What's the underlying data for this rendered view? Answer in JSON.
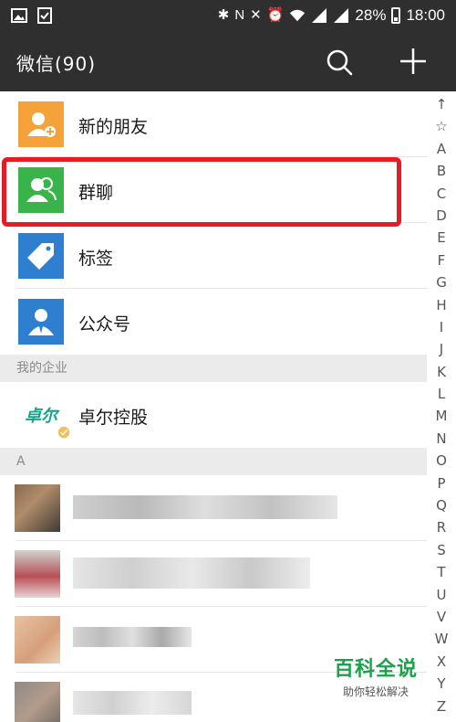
{
  "status_bar": {
    "battery": "28%",
    "time": "18:00",
    "icons": [
      "image-icon",
      "checklist-icon",
      "bluetooth-icon",
      "nfc-icon",
      "mute-icon",
      "alarm-icon",
      "wifi-icon",
      "signal-icon",
      "signal-icon",
      "battery-icon"
    ]
  },
  "header": {
    "title": "微信(90)",
    "search_icon": "search-icon",
    "add_icon": "plus-icon"
  },
  "top_items": [
    {
      "label": "新的朋友",
      "icon": "new-friend-icon",
      "color": "#f5a23a"
    },
    {
      "label": "群聊",
      "icon": "group-chat-icon",
      "color": "#3ab44a"
    },
    {
      "label": "标签",
      "icon": "tag-icon",
      "color": "#2f7fd1"
    },
    {
      "label": "公众号",
      "icon": "official-account-icon",
      "color": "#2f7fd1"
    }
  ],
  "enterprise_section": {
    "header": "我的企业",
    "item": {
      "label": "卓尔控股",
      "logo_text": "卓尔",
      "logo_color": "#18a38a"
    }
  },
  "contacts_section": {
    "header": "A"
  },
  "index_letters": [
    "↑",
    "☆",
    "A",
    "B",
    "C",
    "D",
    "E",
    "F",
    "G",
    "H",
    "I",
    "J",
    "K",
    "L",
    "M",
    "N",
    "O",
    "P",
    "Q",
    "R",
    "S",
    "T",
    "U",
    "V",
    "W",
    "X",
    "Y",
    "Z"
  ],
  "watermark": {
    "title": "百科全说",
    "subtitle": "助你轻松解决"
  },
  "colors": {
    "bar": "#2f2f2f",
    "highlight": "#e51c23"
  }
}
